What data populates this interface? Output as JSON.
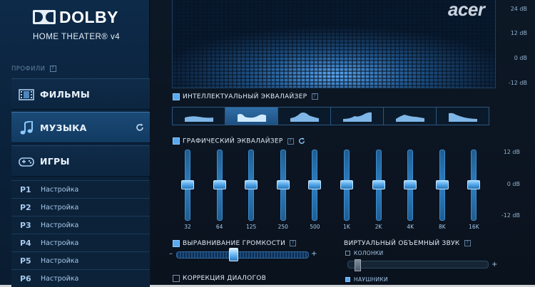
{
  "logo": {
    "brand": "DOLBY",
    "subtitle": "HOME THEATER® v4"
  },
  "profiles_label": "ПРОФИЛИ",
  "nav": [
    {
      "label": "ФИЛЬМЫ",
      "icon": "film-icon"
    },
    {
      "label": "МУЗЫКА",
      "icon": "music-note-icon",
      "active": true
    },
    {
      "label": "ИГРЫ",
      "icon": "gamepad-icon"
    }
  ],
  "presets": [
    {
      "id": "P1",
      "name": "Настройка"
    },
    {
      "id": "P2",
      "name": "Настройка"
    },
    {
      "id": "P3",
      "name": "Настройка"
    },
    {
      "id": "P4",
      "name": "Настройка"
    },
    {
      "id": "P5",
      "name": "Настройка"
    },
    {
      "id": "P6",
      "name": "Настройка"
    }
  ],
  "visualizer": {
    "brand": "acer",
    "scale": [
      "24 dB",
      "12 dB",
      "0 dB",
      "-12 dB"
    ]
  },
  "intelligent_eq": {
    "title": "ИНТЕЛЛЕКТУАЛЬНЫЙ ЭКВАЛАЙЗЕР",
    "checked": true,
    "active_preset": 1,
    "preset_icons": [
      "eq-curve-flat-icon",
      "eq-curve-bass-treble-icon",
      "eq-curve-mid-bump-icon",
      "eq-curve-rising-icon",
      "eq-curve-mid-flat-icon",
      "eq-curve-falling-icon"
    ]
  },
  "graphic_eq": {
    "title": "ГРАФИЧЕСКИЙ ЭКВАЛАЙЗЕР",
    "checked": true,
    "scale": [
      "12 dB",
      "0 dB",
      "-12 dB"
    ],
    "bands": [
      "32",
      "64",
      "125",
      "250",
      "500",
      "1K",
      "2K",
      "4K",
      "8K",
      "16K"
    ],
    "levels_db": [
      0,
      0,
      0,
      0,
      0,
      0,
      0,
      0,
      0,
      0
    ]
  },
  "volume_leveler": {
    "title": "ВЫРАВНИВАНИЕ ГРОМКОСТИ",
    "checked": true,
    "minus": "–",
    "plus": "+",
    "level": 0.43
  },
  "dialog_enhancer": {
    "title": "КОРРЕКЦИЯ ДИАЛОГОВ",
    "checked": false
  },
  "virtual_surround": {
    "title": "ВИРТУАЛЬНЫЙ ОБЪЕМНЫЙ ЗВУК",
    "speakers_label": "КОЛОНКИ",
    "headphones_label": "НАУШНИКИ",
    "mode": "headphones",
    "level": 0.0
  },
  "colors": {
    "accent": "#5aa9ee",
    "panel": "#0a121d",
    "sidebar": "#0d2a49"
  }
}
